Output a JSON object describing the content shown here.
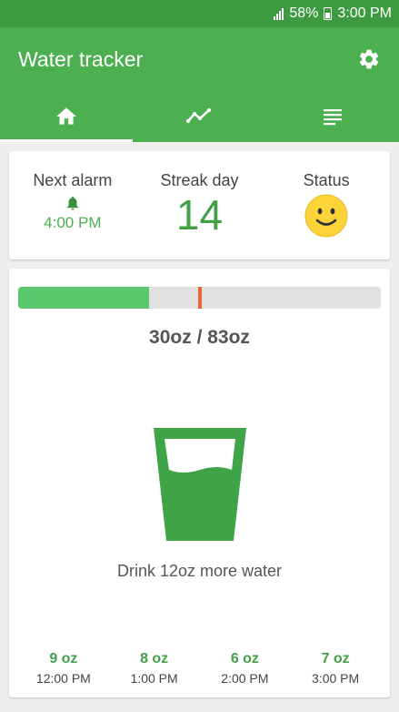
{
  "status_bar": {
    "battery": "58%",
    "time": "3:00 PM"
  },
  "app_bar": {
    "title": "Water tracker",
    "settings_icon": "gear-icon"
  },
  "tabs": [
    {
      "icon": "home-icon",
      "active": true
    },
    {
      "icon": "trend-chart-icon",
      "active": false
    },
    {
      "icon": "list-icon",
      "active": false
    }
  ],
  "summary": {
    "next_alarm_label": "Next alarm",
    "next_alarm_time": "4:00 PM",
    "streak_label": "Streak day",
    "streak_value": "14",
    "status_label": "Status",
    "status_icon": "smiley-icon"
  },
  "progress": {
    "fraction": 0.36,
    "goal_marker_fraction": 0.5,
    "amount_text": "30oz / 83oz"
  },
  "reminder": {
    "text": "Drink 12oz more water"
  },
  "log": [
    {
      "amount": "9 oz",
      "time": "12:00 PM"
    },
    {
      "amount": "8 oz",
      "time": "1:00 PM"
    },
    {
      "amount": "6 oz",
      "time": "2:00 PM"
    },
    {
      "amount": "7 oz",
      "time": "3:00 PM"
    }
  ],
  "colors": {
    "primary": "#4caf50",
    "status_bar": "#3d9a40",
    "progress_fill": "#5ac86b",
    "progress_marker": "#e8663a",
    "glass": "#3fa447"
  }
}
